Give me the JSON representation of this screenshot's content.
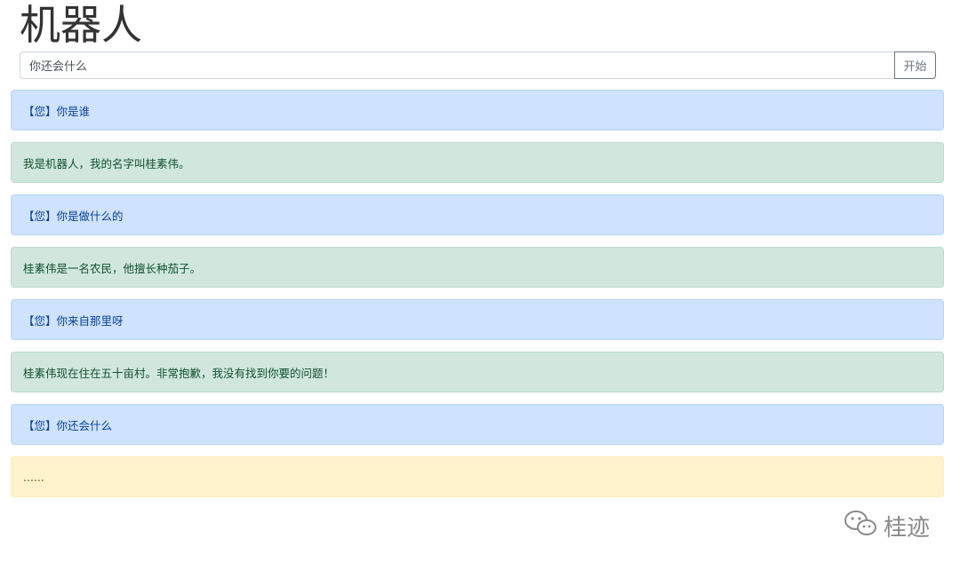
{
  "header": {
    "title": "机器人"
  },
  "query": {
    "value": "你还会什么",
    "submit_label": "开始"
  },
  "messages": [
    {
      "kind": "user",
      "text": "【您】你是谁"
    },
    {
      "kind": "bot",
      "text": "我是机器人，我的名字叫桂素伟。"
    },
    {
      "kind": "user",
      "text": "【您】你是做什么的"
    },
    {
      "kind": "bot",
      "text": "桂素伟是一名农民，他擅长种茄子。"
    },
    {
      "kind": "user",
      "text": "【您】你来自那里呀"
    },
    {
      "kind": "bot",
      "text": "桂素伟现在住在五十亩村。非常抱歉，我没有找到你要的问题！"
    },
    {
      "kind": "user",
      "text": "【您】你还会什么"
    },
    {
      "kind": "wait",
      "text": "......"
    }
  ],
  "watermark": {
    "icon": "wechat-icon",
    "text": "桂迹"
  },
  "colors": {
    "user_bg": "#cfe2ff",
    "user_text": "#084298",
    "bot_bg": "#d1e7dd",
    "bot_text": "#0f5132",
    "wait_bg": "#fff3cd",
    "wait_text": "#664d03"
  }
}
